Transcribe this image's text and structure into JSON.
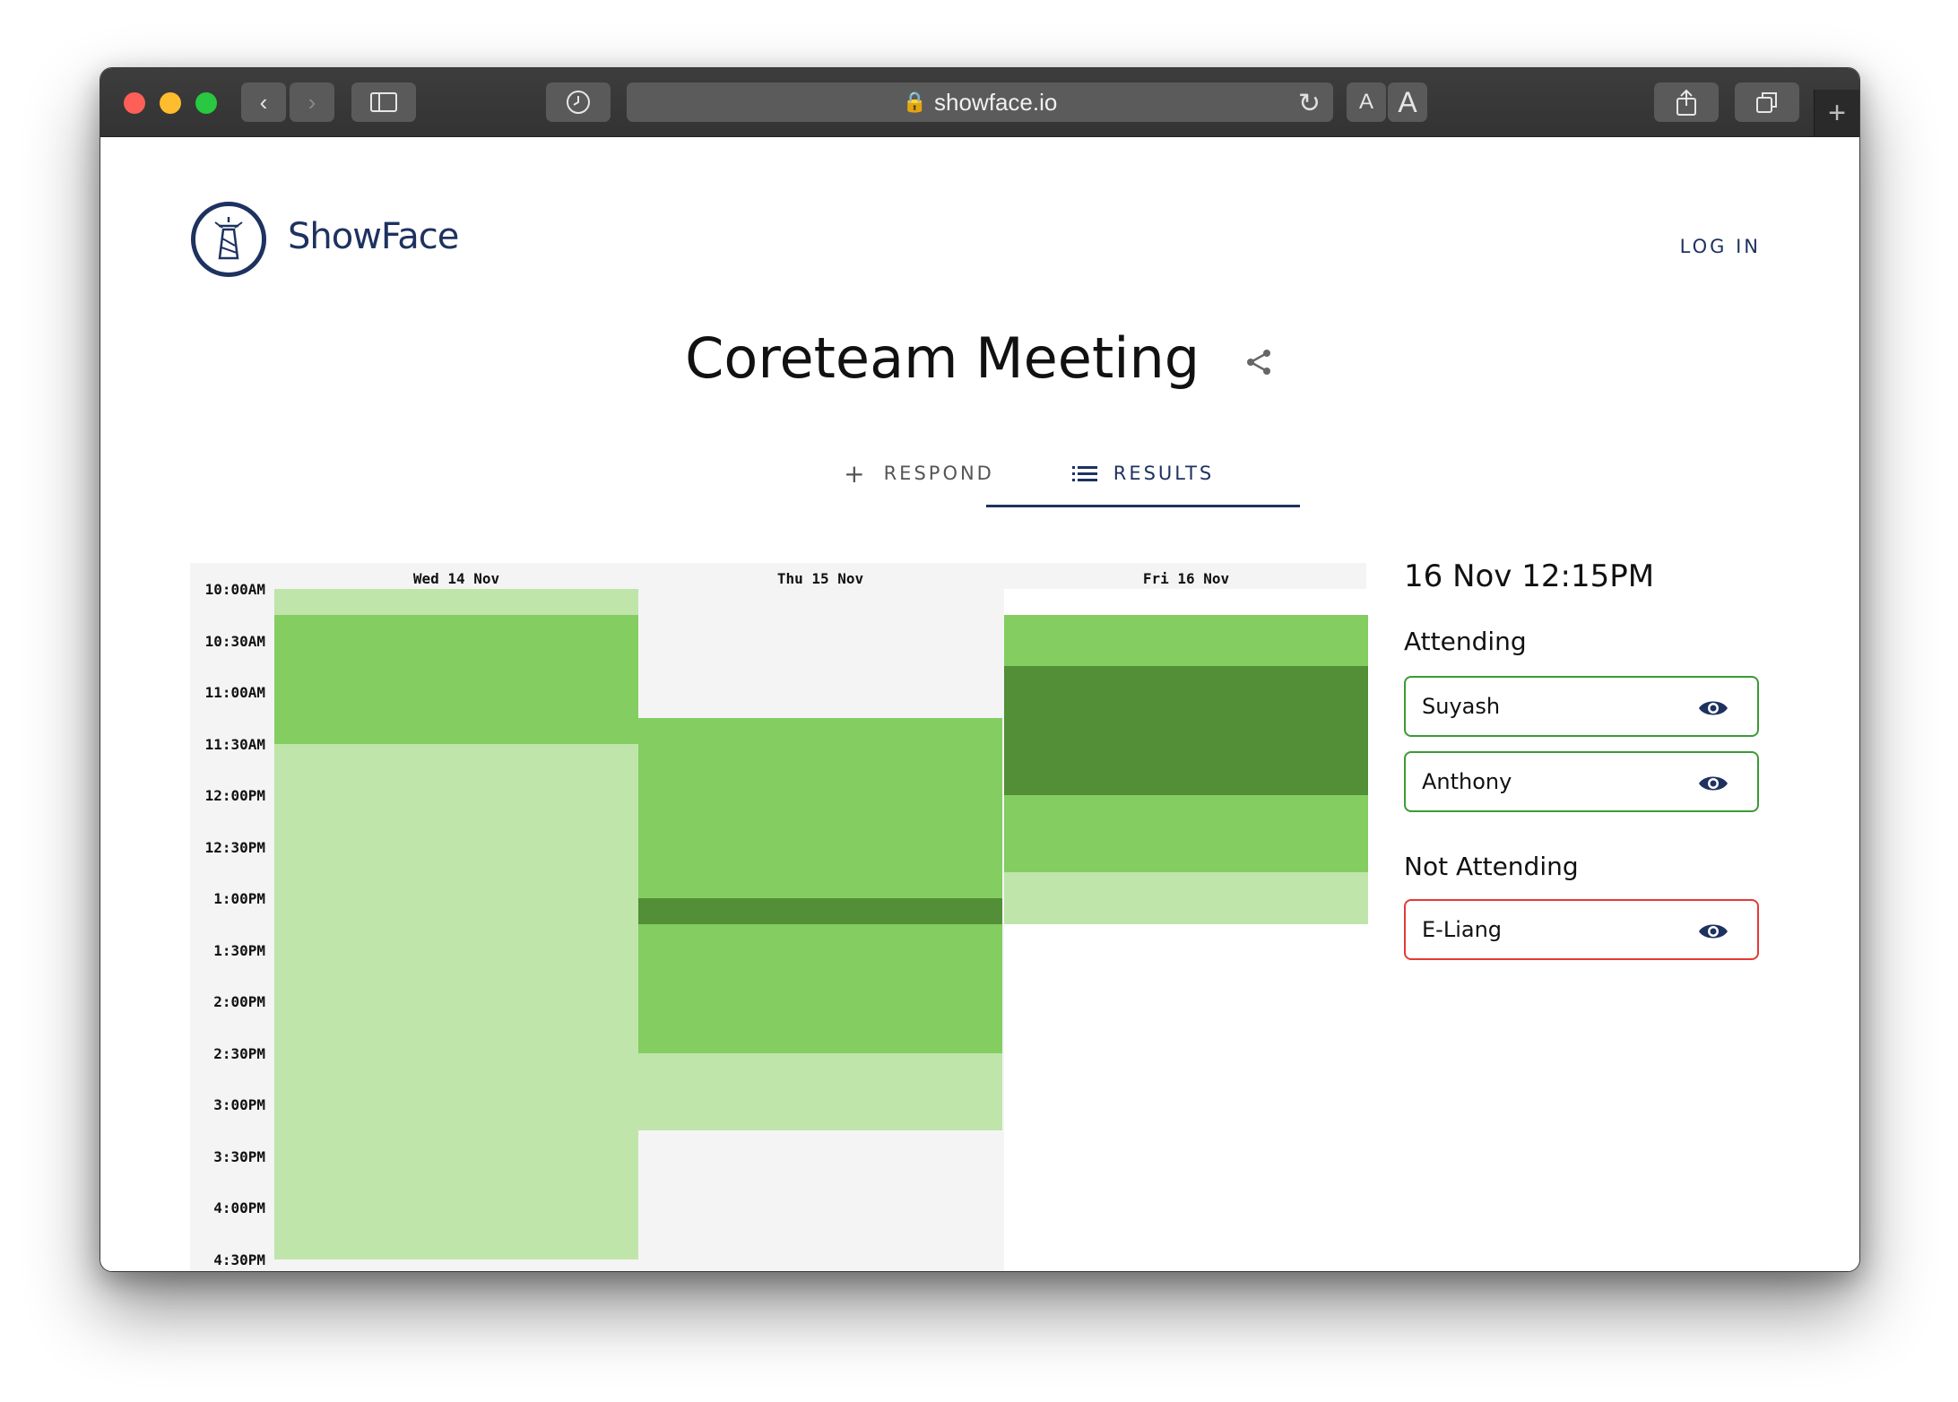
{
  "browser": {
    "url": "showface.io",
    "font_small_label": "A",
    "font_large_label": "A"
  },
  "header": {
    "logo_text": "ShowFace",
    "login_label": "LOG IN"
  },
  "event": {
    "title": "Coreteam Meeting"
  },
  "tabs": [
    {
      "label": "RESPOND",
      "icon": "plus-icon",
      "active": false
    },
    {
      "label": "RESULTS",
      "icon": "list-icon",
      "active": true
    }
  ],
  "colors": {
    "brand": "#1e3260",
    "avail_0": "#f4f4f4",
    "avail_1": "#bfe5aa",
    "avail_2": "#84cd61",
    "avail_3": "#528f37",
    "attending_border": "#3c9a36",
    "not_attending_border": "#e53935"
  },
  "schedule": {
    "time_labels": [
      "10:00AM",
      "10:30AM",
      "11:00AM",
      "11:30AM",
      "12:00PM",
      "12:30PM",
      "1:00PM",
      "1:30PM",
      "2:00PM",
      "2:30PM",
      "3:00PM",
      "3:30PM",
      "4:00PM",
      "4:30PM"
    ],
    "days": [
      {
        "label": "Wed 14 Nov",
        "blocks": [
          {
            "start": "10:00AM",
            "end": "10:15AM",
            "count": 1
          },
          {
            "start": "10:15AM",
            "end": "11:30AM",
            "count": 2
          },
          {
            "start": "11:30AM",
            "end": "4:30PM",
            "count": 1
          }
        ]
      },
      {
        "label": "Thu 15 Nov",
        "blocks": [
          {
            "start": "10:00AM",
            "end": "11:15AM",
            "count": 0
          },
          {
            "start": "11:15AM",
            "end": "1:00PM",
            "count": 2
          },
          {
            "start": "1:00PM",
            "end": "1:15PM",
            "count": 3
          },
          {
            "start": "1:15PM",
            "end": "2:30PM",
            "count": 2
          },
          {
            "start": "2:30PM",
            "end": "3:15PM",
            "count": 1
          },
          {
            "start": "3:15PM",
            "end": "4:30PM",
            "count": 0
          }
        ]
      },
      {
        "label": "Fri 16 Nov",
        "blocks": [
          {
            "start": "10:15AM",
            "end": "10:45AM",
            "count": 2
          },
          {
            "start": "10:45AM",
            "end": "12:00PM",
            "count": 3
          },
          {
            "start": "12:00PM",
            "end": "12:45PM",
            "count": 2
          },
          {
            "start": "12:45PM",
            "end": "1:15PM",
            "count": 1
          }
        ]
      }
    ]
  },
  "results": {
    "selected_slot": "16 Nov 12:15PM",
    "attending_heading": "Attending",
    "attending": [
      "Suyash",
      "Anthony"
    ],
    "not_attending_heading": "Not Attending",
    "not_attending": [
      "E-Liang"
    ]
  }
}
